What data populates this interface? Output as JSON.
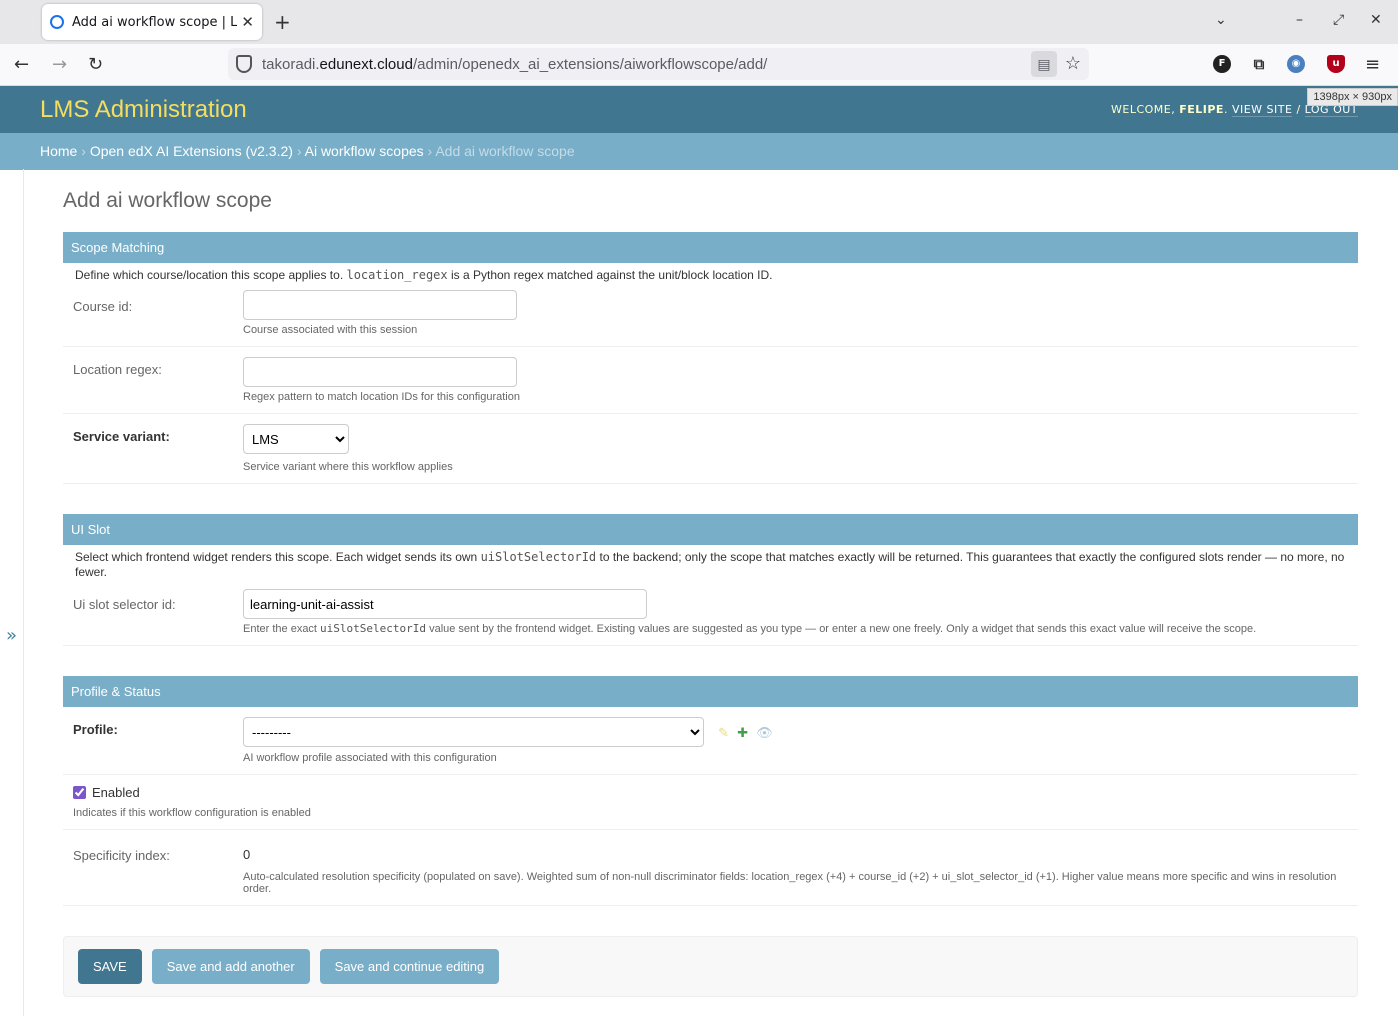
{
  "browser": {
    "tab_title": "Add ai workflow scope | LMS",
    "url_prefix": "takoradi.",
    "url_host": "edunext.cloud",
    "url_path": "/admin/openedx_ai_extensions/aiworkflowscope/add/",
    "size_badge": "1398px × 930px"
  },
  "header": {
    "branding": "LMS Administration",
    "welcome": "WELCOME, ",
    "user": "FELIPE",
    "view_site": "VIEW SITE",
    "separator": " / ",
    "log_out": "LOG OUT"
  },
  "breadcrumbs": {
    "home": "Home",
    "app": "Open edX AI Extensions (v2.3.2)",
    "model": "Ai workflow scopes",
    "current": "Add ai workflow scope"
  },
  "page_title": "Add ai workflow scope",
  "scope_matching": {
    "title": "Scope Matching",
    "desc_pre": "Define which course/location this scope applies to. ",
    "desc_code": "location_regex",
    "desc_post": " is a Python regex matched against the unit/block location ID.",
    "course_id_label": "Course id:",
    "course_id_value": "",
    "course_id_help": "Course associated with this session",
    "location_label": "Location regex:",
    "location_value": "",
    "location_help": "Regex pattern to match location IDs for this configuration",
    "variant_label": "Service variant:",
    "variant_value": "LMS",
    "variant_help": "Service variant where this workflow applies"
  },
  "ui_slot": {
    "title": "UI Slot",
    "desc_pre": "Select which frontend widget renders this scope. Each widget sends its own ",
    "desc_code": "uiSlotSelectorId",
    "desc_post": " to the backend; only the scope that matches exactly will be returned. This guarantees that exactly the configured slots render — no more, no fewer.",
    "selector_label": "Ui slot selector id:",
    "selector_value": "learning-unit-ai-assist",
    "help_pre": "Enter the exact ",
    "help_code": "uiSlotSelectorId",
    "help_post": " value sent by the frontend widget. Existing values are suggested as you type — or enter a new one freely. Only a widget that sends this exact value will receive the scope."
  },
  "profile_status": {
    "title": "Profile & Status",
    "profile_label": "Profile:",
    "profile_value": "---------",
    "profile_help": "AI workflow profile associated with this configuration",
    "enabled_label": "Enabled",
    "enabled_checked": true,
    "enabled_help": "Indicates if this workflow configuration is enabled",
    "specificity_label": "Specificity index:",
    "specificity_value": "0",
    "specificity_help": "Auto-calculated resolution specificity (populated on save). Weighted sum of non-null discriminator fields: location_regex (+4) + course_id (+2) + ui_slot_selector_id (+1). Higher value means more specific and wins in resolution order."
  },
  "actions": {
    "save": "SAVE",
    "save_add_another": "Save and add another",
    "save_continue": "Save and continue editing"
  },
  "colors": {
    "header": "#417690",
    "breadcrumbs": "#79aec8",
    "branding": "#f5dd5d"
  }
}
